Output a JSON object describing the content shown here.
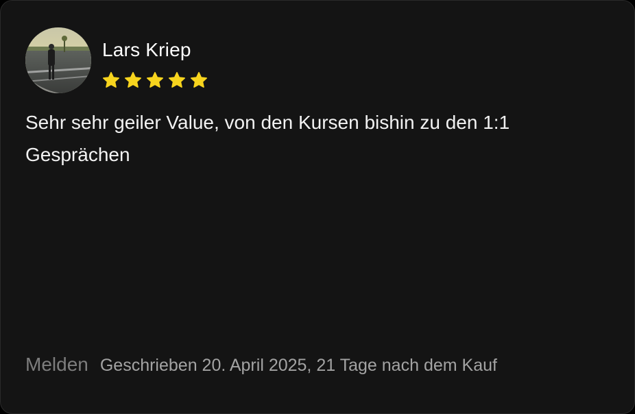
{
  "review": {
    "author": "Lars Kriep",
    "rating": 5,
    "max_rating": 5,
    "star_color": "#f7d41e",
    "text": "Sehr sehr geiler Value, von den Kursen bishin zu den 1:1 Gesprächen",
    "footer": {
      "report_label": "Melden",
      "meta": "Geschrieben 20. April 2025, 21 Tage nach dem Kauf"
    }
  }
}
